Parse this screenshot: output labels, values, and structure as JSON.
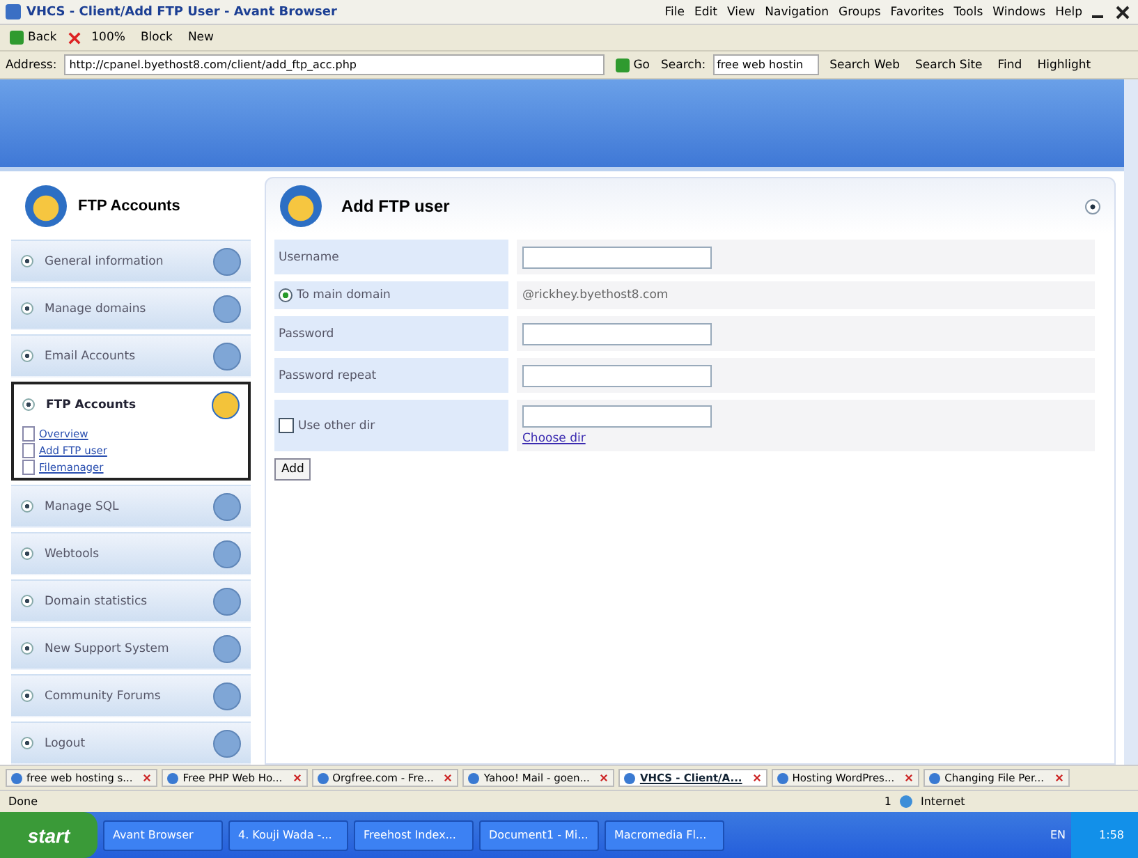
{
  "window": {
    "title": "VHCS - Client/Add FTP User - Avant Browser"
  },
  "menu": [
    "File",
    "Edit",
    "View",
    "Navigation",
    "Groups",
    "Favorites",
    "Tools",
    "Windows",
    "Help"
  ],
  "toolbar": {
    "back": "Back",
    "zoom": "100%",
    "block": "Block",
    "new": "New"
  },
  "address": {
    "label": "Address:",
    "url": "http://cpanel.byethost8.com/client/add_ftp_acc.php",
    "go": "Go",
    "search_label": "Search:",
    "search_value": "free web hostin",
    "search_web": "Search Web",
    "search_site": "Search Site",
    "find": "Find",
    "highlight": "Highlight"
  },
  "sidebar": {
    "title": "FTP Accounts",
    "items": [
      {
        "label": "General information",
        "expanded": false
      },
      {
        "label": "Manage domains",
        "expanded": false
      },
      {
        "label": "Email Accounts",
        "expanded": false
      },
      {
        "label": "FTP Accounts",
        "expanded": true,
        "children": [
          "Overview",
          "Add FTP user",
          "Filemanager"
        ]
      },
      {
        "label": "Manage SQL",
        "expanded": false
      },
      {
        "label": "Webtools",
        "expanded": false
      },
      {
        "label": "Domain statistics",
        "expanded": false
      },
      {
        "label": "New Support System",
        "expanded": false
      },
      {
        "label": "Community Forums",
        "expanded": false
      },
      {
        "label": "Logout",
        "expanded": false
      }
    ]
  },
  "panel": {
    "title": "Add FTP user",
    "rows": [
      {
        "kind": "input",
        "label": "Username"
      },
      {
        "kind": "radio",
        "label": "To main domain",
        "selected": true,
        "value": "@rickhey.byethost8.com"
      },
      {
        "kind": "input",
        "label": "Password"
      },
      {
        "kind": "input",
        "label": "Password repeat"
      },
      {
        "kind": "checkbox",
        "label": "Use other dir",
        "checked": false,
        "link": "Choose dir"
      }
    ],
    "button": "Add"
  },
  "tabs": [
    {
      "label": "free web hosting s...",
      "selected": false
    },
    {
      "label": "Free PHP Web Ho...",
      "selected": false
    },
    {
      "label": "Orgfree.com - Fre...",
      "selected": false
    },
    {
      "label": "Yahoo! Mail - goen...",
      "selected": false
    },
    {
      "label": "VHCS - Client/A...",
      "selected": true
    },
    {
      "label": "Hosting WordPres...",
      "selected": false
    },
    {
      "label": "Changing File Per...",
      "selected": false
    }
  ],
  "status_bar": {
    "text": "Done",
    "zone": "Internet",
    "count": "1"
  },
  "taskbar": {
    "start": "start",
    "tasks": [
      "Avant Browser",
      "4. Kouji Wada -...",
      "Freehost Index...",
      "Document1 - Mi...",
      "Macromedia Fl..."
    ],
    "lang": "EN",
    "clock": "1:58"
  }
}
